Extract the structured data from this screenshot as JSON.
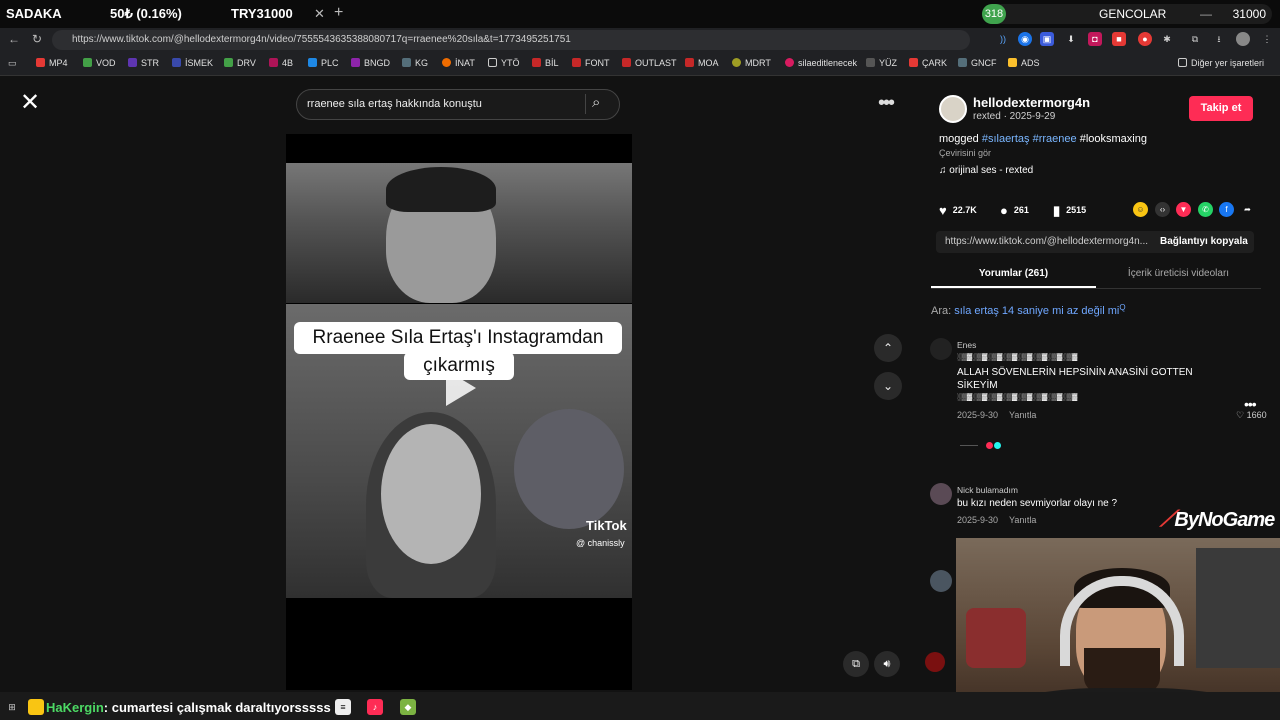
{
  "stream": {
    "left_label": "SADAKA",
    "stat1": "50₺ (0.16%)",
    "stat2": "TRY31000",
    "hp_value": "318",
    "team": "GENCOLAR",
    "points": "31000"
  },
  "browser": {
    "url": "https://www.tiktok.com/@hellodextermorg4n/video/7555543635388080717q=rraenee%20sıla&t=1773495251751",
    "bookmarks": [
      "MP4",
      "VOD",
      "STR",
      "İSMEK",
      "DRV",
      "4B",
      "PLC",
      "BNGD",
      "KG",
      "İNAT",
      "YTÖ",
      "BİL",
      "FONT",
      "OUTLAST",
      "MOA",
      "MDRT",
      "silaeditlenecek",
      "YÜZ",
      "ÇARK",
      "GNCF",
      "ADS"
    ],
    "other_bookmarks": "Diğer yer işaretleri"
  },
  "player": {
    "search_text": "rraenee sıla ertaş hakkında konuştu",
    "caption_line1": "Rraenee Sıla Ertaş'ı Instagramdan",
    "caption_line2": "çıkarmış",
    "watermark": "TikTok",
    "watermark_user": "@ chanissly"
  },
  "post": {
    "username": "hellodextermorg4n",
    "meta": "rexted · 2025-9-29",
    "follow_label": "Takip et",
    "desc_word": "mogged",
    "tag1": "#sılaertaş",
    "tag2": "#rraenee",
    "tag3": "#looksmaxing",
    "translate": "Çevirisini gör",
    "sound": "orijinal ses - rexted",
    "likes": "22.7K",
    "comments": "261",
    "saves": "2515",
    "link": "https://www.tiktok.com/@hellodextermorg4n...",
    "copy_label": "Bağlantıyı kopyala",
    "tab_comments": "Yorumlar (261)",
    "tab_creator": "İçerik üreticisi videoları",
    "search_prefix": "Ara:",
    "search_query": "sıla ertaş 14 saniye mi az değil mi"
  },
  "comments": [
    {
      "name": "Enes",
      "deco": "░▒▓░▒▓░▒▓░▒▓░▒▓░▒▓░▒▓░▒▓",
      "text": "ALLAH SÖVENLERİN HEPSİNİN ANASİNİ GOTTEN SİKEYİM",
      "date": "2025-9-30",
      "reply": "Yanıtla",
      "likes": "1660"
    },
    {
      "name": "Nick bulamadım",
      "text": "bu kızı neden sevmiyorlar olayı ne ?",
      "date": "2025-9-30",
      "reply": "Yanıtla"
    }
  ],
  "overlay": {
    "brand": "ByNoGame",
    "chat_user": "HaKergin",
    "chat_text": ": cumartesi çalışmak daraltıyorsssss"
  }
}
